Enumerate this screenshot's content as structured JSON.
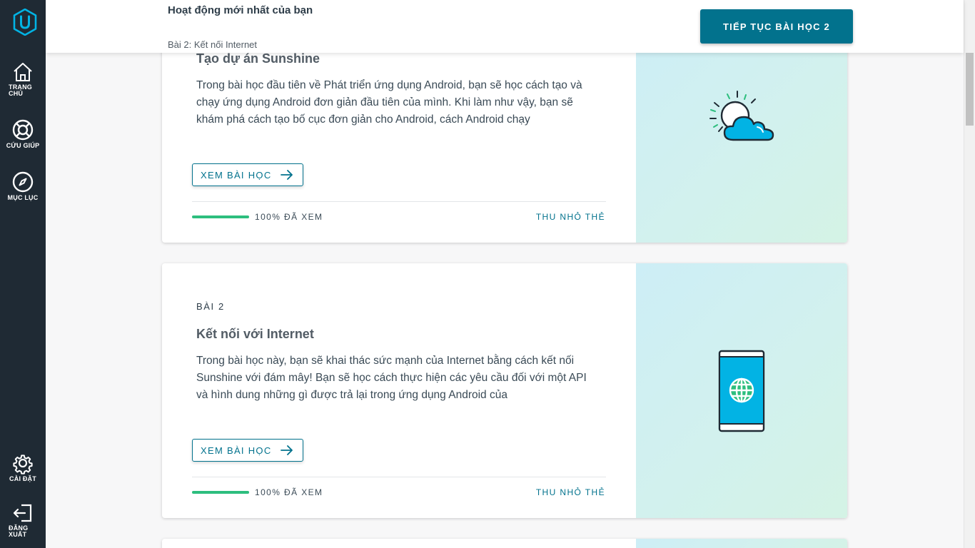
{
  "sidebar": {
    "items": [
      {
        "label": "TRANG CHỦ",
        "icon": "home-icon"
      },
      {
        "label": "CỨU GIÚP",
        "icon": "lifebuoy-icon"
      },
      {
        "label": "MỤC LỤC",
        "icon": "compass-icon"
      },
      {
        "label": "CÀI ĐẶT",
        "icon": "gear-icon"
      },
      {
        "label": "ĐĂNG XUẤT",
        "icon": "logout-icon"
      }
    ]
  },
  "header": {
    "title": "Hoạt động mới nhất của bạn",
    "subtitle": "Bài 2: Kết nối Internet",
    "continue_label": "TIẾP TỤC BÀI HỌC 2"
  },
  "lessons": [
    {
      "title": "Tạo dự án Sunshine",
      "description": "Trong bài học đầu tiên về Phát triển ứng dụng Android, bạn sẽ học cách tạo và chạy ứng dụng Android đơn giản đầu tiên của mình. Khi làm như vậy, bạn sẽ khám phá cách tạo bố cục đơn giản cho Android, cách Android chạy",
      "view_label": "XEM BÀI HỌC",
      "progress": 1.0,
      "progress_text": "100% ĐÃ XEM",
      "collapse_label": "THU NHỎ THẺ",
      "art_icon": "weather-sun-cloud-icon"
    },
    {
      "label": "BÀI 2",
      "title": "Kết nối với Internet",
      "description": "Trong bài học này, bạn sẽ khai thác sức mạnh của Internet bằng cách kết nối Sunshine với đám mây! Bạn sẽ học cách thực hiện các yêu cầu đối với một API và hình dung những gì được trả lại trong ứng dụng Android của",
      "view_label": "XEM BÀI HỌC",
      "progress": 1.0,
      "progress_text": "100% ĐÃ XEM",
      "collapse_label": "THU NHỎ THẺ",
      "art_icon": "phone-globe-icon"
    }
  ],
  "colors": {
    "sidebar_bg": "#1f2a34",
    "accent": "#02728d",
    "progress": "#2dbe7e"
  }
}
